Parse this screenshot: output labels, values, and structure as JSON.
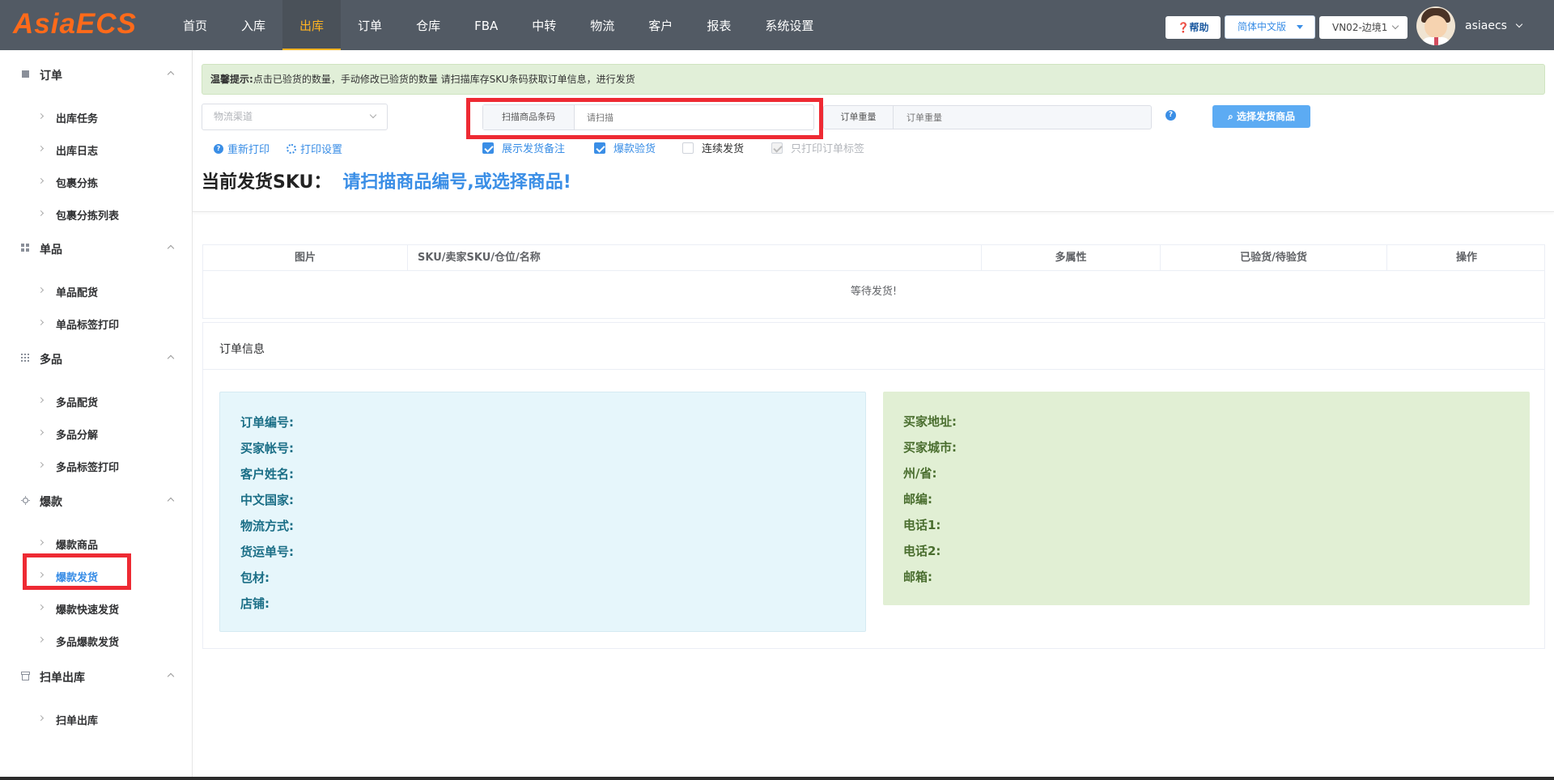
{
  "app": {
    "logo": "AsiaECS"
  },
  "nav": {
    "items": [
      {
        "label": "首页"
      },
      {
        "label": "入库"
      },
      {
        "label": "出库"
      },
      {
        "label": "订单"
      },
      {
        "label": "仓库"
      },
      {
        "label": "FBA"
      },
      {
        "label": "中转"
      },
      {
        "label": "物流"
      },
      {
        "label": "客户"
      },
      {
        "label": "报表"
      },
      {
        "label": "系统设置"
      }
    ],
    "active": "出库"
  },
  "header": {
    "help_label": "❓帮助",
    "lang_label": "简体中文版",
    "warehouse_label": "VN02-边境1",
    "username": "asiaecs"
  },
  "sidebar": {
    "groups": [
      {
        "label": "订单",
        "items": [
          {
            "label": "出库任务"
          },
          {
            "label": "出库日志"
          },
          {
            "label": "包裹分拣"
          },
          {
            "label": "包裹分拣列表"
          }
        ]
      },
      {
        "label": "单品",
        "items": [
          {
            "label": "单品配货"
          },
          {
            "label": "单品标签打印"
          }
        ]
      },
      {
        "label": "多品",
        "items": [
          {
            "label": "多品配货"
          },
          {
            "label": "多品分解"
          },
          {
            "label": "多品标签打印"
          }
        ]
      },
      {
        "label": "爆款",
        "items": [
          {
            "label": "爆款商品"
          },
          {
            "label": "爆款发货"
          },
          {
            "label": "爆款快速发货"
          },
          {
            "label": "多品爆款发货"
          }
        ]
      },
      {
        "label": "扫单出库",
        "items": [
          {
            "label": "扫单出库"
          }
        ]
      }
    ],
    "active_item": "爆款发货"
  },
  "tip": {
    "title": "温馨提示:",
    "text": "点击已验货的数量，手动修改已验货的数量 请扫描库存SKU条码获取订单信息，进行发货"
  },
  "toolbar": {
    "channel_placeholder": "物流渠道",
    "scan_label": "扫描商品条码",
    "scan_placeholder": "请扫描",
    "weight_label": "订单重量",
    "weight_placeholder": "订单重量",
    "help_icon": "?",
    "choose_button": "选择发货商品",
    "reprint_label": "重新打印",
    "print_settings_label": "打印设置",
    "checkboxes": [
      {
        "label": "展示发货备注",
        "checked": true
      },
      {
        "label": "爆款验货",
        "checked": true
      },
      {
        "label": "连续发货",
        "checked": false
      },
      {
        "label": "只打印订单标签",
        "checked": true,
        "disabled": true
      }
    ]
  },
  "current_sku": {
    "label": "当前发货SKU：",
    "value": "请扫描商品编号,或选择商品!"
  },
  "table": {
    "columns": [
      "图片",
      "SKU/卖家SKU/仓位/名称",
      "多属性",
      "已验货/待验货",
      "操作"
    ],
    "empty_text": "等待发货!"
  },
  "order_info": {
    "title": "订单信息",
    "left_fields": [
      "订单编号:",
      "买家帐号:",
      "客户姓名:",
      "中文国家:",
      "物流方式:",
      "货运单号:",
      "包材:",
      "店铺:"
    ],
    "right_fields": [
      "买家地址:",
      "买家城市:",
      "州/省:",
      "邮编:",
      "电话1:",
      "电话2:",
      "邮箱:"
    ]
  },
  "colors": {
    "topbar": "#525a64",
    "accent": "#3a8ee6",
    "active_nav": "#ffb422",
    "highlight": "#ee2a33"
  }
}
